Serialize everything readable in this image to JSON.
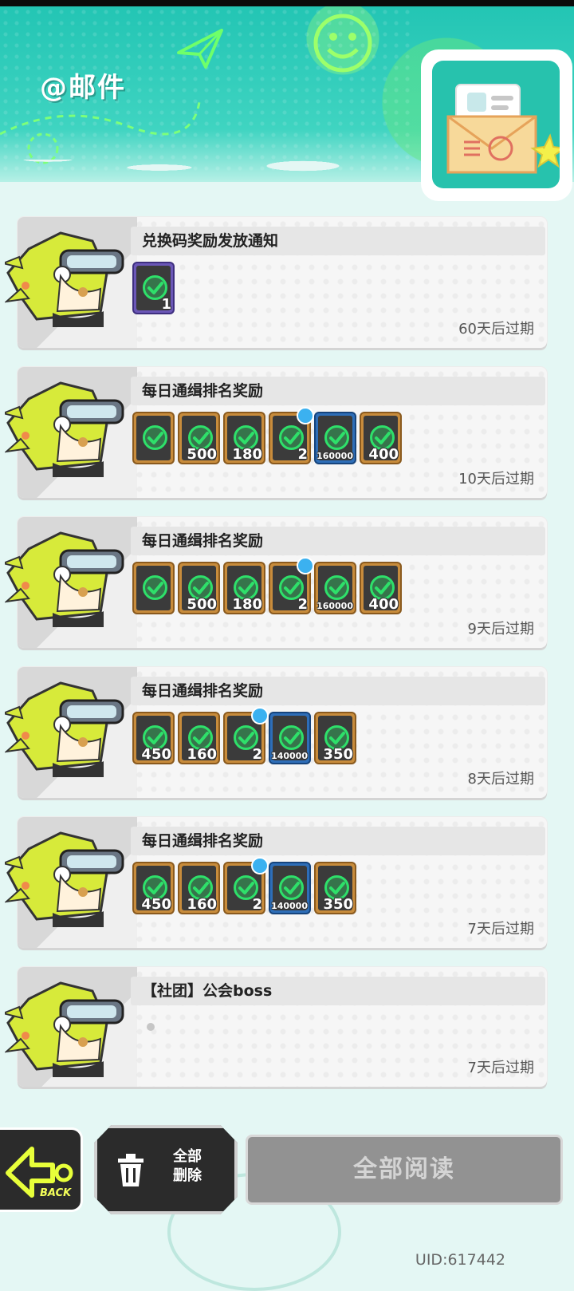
{
  "header": {
    "title": "@邮件"
  },
  "mails": [
    {
      "subject": "兑换码奖励发放通知",
      "expiry": "60天后过期",
      "items": [
        {
          "frame": "purple",
          "qty": "1",
          "badge": false
        }
      ]
    },
    {
      "subject": "每日通缉排名奖励",
      "expiry": "10天后过期",
      "items": [
        {
          "frame": "gold",
          "qty": "",
          "badge": false
        },
        {
          "frame": "gold",
          "qty": "500",
          "badge": false
        },
        {
          "frame": "gold",
          "qty": "180",
          "badge": false
        },
        {
          "frame": "gold",
          "qty": "2",
          "badge": true
        },
        {
          "frame": "blue",
          "qty": "160000",
          "badge": false
        },
        {
          "frame": "gold",
          "qty": "400",
          "badge": false
        }
      ]
    },
    {
      "subject": "每日通缉排名奖励",
      "expiry": "9天后过期",
      "items": [
        {
          "frame": "gold",
          "qty": "",
          "badge": false
        },
        {
          "frame": "gold",
          "qty": "500",
          "badge": false
        },
        {
          "frame": "gold",
          "qty": "180",
          "badge": false
        },
        {
          "frame": "gold",
          "qty": "2",
          "badge": true
        },
        {
          "frame": "gold",
          "qty": "160000",
          "badge": false
        },
        {
          "frame": "gold",
          "qty": "400",
          "badge": false
        }
      ]
    },
    {
      "subject": "每日通缉排名奖励",
      "expiry": "8天后过期",
      "items": [
        {
          "frame": "gold",
          "qty": "450",
          "badge": false
        },
        {
          "frame": "gold",
          "qty": "160",
          "badge": false
        },
        {
          "frame": "gold",
          "qty": "2",
          "badge": true
        },
        {
          "frame": "blue",
          "qty": "140000",
          "badge": false
        },
        {
          "frame": "gold",
          "qty": "350",
          "badge": false
        }
      ]
    },
    {
      "subject": "每日通缉排名奖励",
      "expiry": "7天后过期",
      "items": [
        {
          "frame": "gold",
          "qty": "450",
          "badge": false
        },
        {
          "frame": "gold",
          "qty": "160",
          "badge": false
        },
        {
          "frame": "gold",
          "qty": "2",
          "badge": true
        },
        {
          "frame": "blue",
          "qty": "140000",
          "badge": false
        },
        {
          "frame": "gold",
          "qty": "350",
          "badge": false
        }
      ]
    },
    {
      "subject": "【社团】公会boss",
      "expiry": "7天后过期",
      "items": []
    }
  ],
  "buttons": {
    "back": "BACK",
    "delete_all": "全部\n删除",
    "read_all": "全部阅读"
  },
  "uid": "UID:617442",
  "colors": {
    "header": "#23c5b4",
    "check": "#2ee06a",
    "gold_frame": "#c88c3c",
    "blue_frame": "#2e6eb8",
    "purple_frame": "#6b57b7"
  },
  "icons": {
    "check": "check-circle-icon",
    "trash": "trash-icon",
    "back": "back-arrow-icon",
    "plane": "paper-plane-icon",
    "envelope": "envelope-icon"
  }
}
